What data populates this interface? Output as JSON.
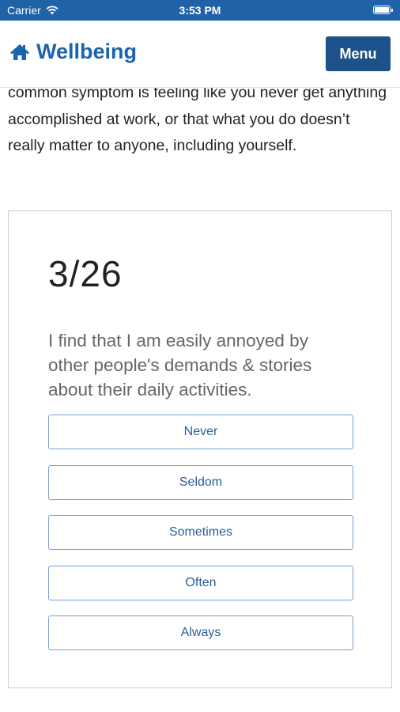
{
  "status_bar": {
    "carrier": "Carrier",
    "time": "3:53 PM"
  },
  "navbar": {
    "brand": "Wellbeing",
    "brand_icon": "home-icon",
    "menu_label": "Menu"
  },
  "intro_text": "common symptom is feeling like you never get anything accomplished at work, or that what you do doesn’t really matter to anyone, including yourself.",
  "quiz": {
    "progress": "3/26",
    "question": "I find that I am easily annoyed by other people's demands & stories about their daily activities.",
    "options": [
      "Never",
      "Seldom",
      "Sometimes",
      "Often",
      "Always"
    ]
  },
  "colors": {
    "status_bar": "#1f62a8",
    "brand": "#1a63ad",
    "menu_button": "#1d5189",
    "option_border": "#7aa0cf",
    "option_text": "#2a5f98"
  }
}
